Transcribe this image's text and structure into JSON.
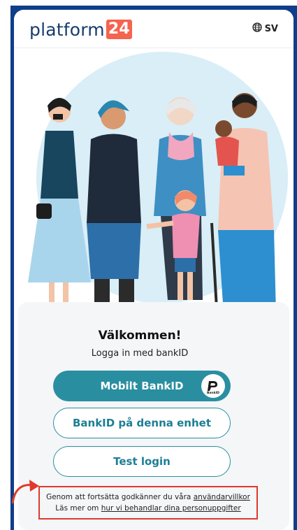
{
  "header": {
    "logo_word": "platform",
    "logo_number": "24",
    "language": "SV"
  },
  "login": {
    "title": "Välkommen!",
    "subtitle": "Logga in med bankID",
    "mobile_bankid_label": "Mobilt BankID",
    "device_bankid_label": "BankID på denna enhet",
    "test_login_label": "Test login",
    "bankid_badge_text": "BankID"
  },
  "consent": {
    "line1_prefix": "Genom att fortsätta godkänner du våra ",
    "terms_link": "användarvillkor",
    "line2_prefix": "Läs mer om ",
    "privacy_link": "hur vi behandlar dina personuppgifter"
  },
  "colors": {
    "frame": "#0f3e8a",
    "accent": "#2a8ea1",
    "logo_badge": "#f4644e",
    "highlight": "#e03a2c"
  },
  "icons": [
    "globe-icon",
    "bankid-logo-icon",
    "curved-arrow-icon"
  ]
}
